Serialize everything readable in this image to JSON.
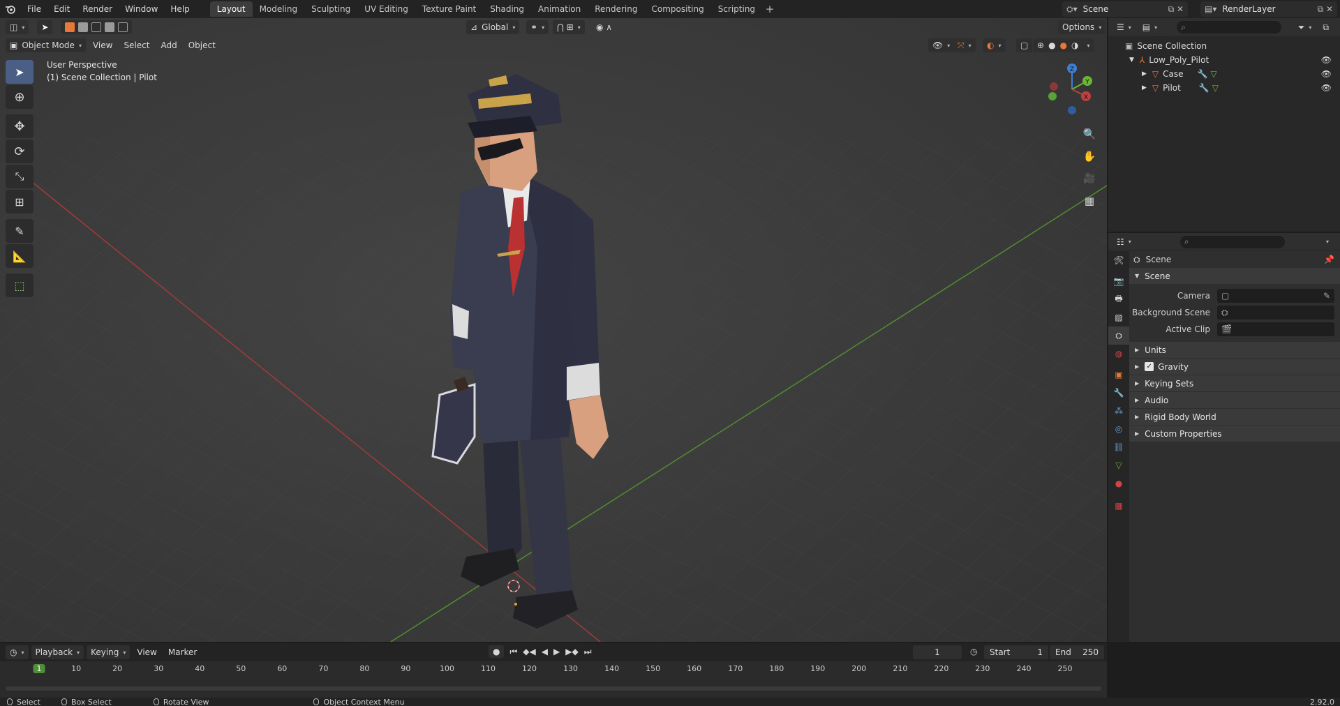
{
  "topbar": {
    "menu": [
      "File",
      "Edit",
      "Render",
      "Window",
      "Help"
    ],
    "workspaces": [
      "Layout",
      "Modeling",
      "Sculpting",
      "UV Editing",
      "Texture Paint",
      "Shading",
      "Animation",
      "Rendering",
      "Compositing",
      "Scripting"
    ],
    "active_workspace": "Layout",
    "scene_name": "Scene",
    "view_layer": "RenderLayer"
  },
  "viewport": {
    "transform_orientation": "Global",
    "options_label": "Options",
    "mode": "Object Mode",
    "menus": [
      "View",
      "Select",
      "Add",
      "Object"
    ],
    "overlay_title": "User Perspective",
    "overlay_subtitle": "(1) Scene Collection | Pilot",
    "gizmo_axes": {
      "z": "Z",
      "y": "Y",
      "x": "X"
    }
  },
  "outliner": {
    "root": "Scene Collection",
    "collection": "Low_Poly_Pilot",
    "objects": [
      "Case",
      "Pilot"
    ]
  },
  "properties": {
    "context_title": "Scene",
    "panel_title": "Scene",
    "camera_label": "Camera",
    "background_scene_label": "Background Scene",
    "active_clip_label": "Active Clip",
    "subpanels": [
      "Units",
      "Gravity",
      "Keying Sets",
      "Audio",
      "Rigid Body World",
      "Custom Properties"
    ]
  },
  "timeline": {
    "menus": [
      "Playback",
      "Keying",
      "View",
      "Marker"
    ],
    "current_frame": "1",
    "start_label": "Start",
    "start_value": "1",
    "end_label": "End",
    "end_value": "250",
    "ruler_ticks": [
      "1",
      "10",
      "20",
      "30",
      "40",
      "50",
      "60",
      "70",
      "80",
      "90",
      "100",
      "110",
      "120",
      "130",
      "140",
      "150",
      "160",
      "170",
      "180",
      "190",
      "200",
      "210",
      "220",
      "230",
      "240",
      "250"
    ]
  },
  "statusbar": {
    "select": "Select",
    "box_select": "Box Select",
    "rotate_view": "Rotate View",
    "context_menu": "Object Context Menu",
    "version": "2.92.0"
  },
  "colors": {
    "accent": "#e8773a",
    "active_tool": "#4b5f86",
    "x_axis": "#c0403f",
    "y_axis": "#6ab733",
    "z_axis": "#3d7fd6"
  }
}
